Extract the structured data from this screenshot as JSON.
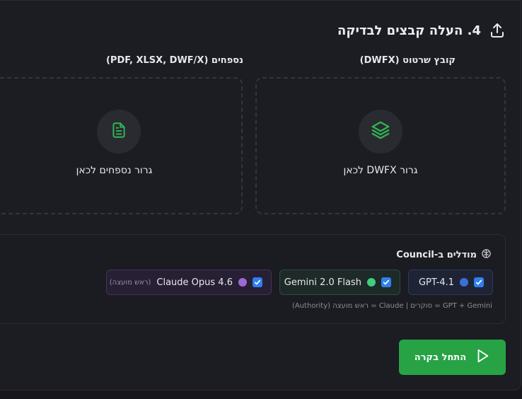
{
  "section": {
    "title": "4. העלה קבצים לבדיקה",
    "icon": "upload-icon"
  },
  "upload": {
    "drawing": {
      "label": "קובץ שרטוט (DWFX)",
      "drop_text": "גרור DWFX לכאן",
      "icon": "layers-icon"
    },
    "attachments": {
      "label": "נספחים (PDF, XLSX, DWF/X)",
      "drop_text": "גרור נספחים לכאן",
      "icon": "file-text-icon"
    }
  },
  "council": {
    "title": "מודלים ב-Council",
    "icon": "brain-icon",
    "models": [
      {
        "name": "GPT-4.1",
        "checked": true,
        "dot_color": "#3b6fd6"
      },
      {
        "name": "Gemini 2.0 Flash",
        "checked": true,
        "dot_color": "#3ecf7a"
      },
      {
        "name": "Claude Opus 4.6",
        "checked": true,
        "dot_color": "#9b6ad6",
        "tag": "(ראש מועצה)"
      }
    ],
    "note": "GPT + Gemini = סוקרים  |  Claude = ראש מועצה (Authority)"
  },
  "actions": {
    "start_label": "התחל בקרה",
    "start_icon": "play-icon"
  },
  "colors": {
    "accent_green": "#27a345",
    "checkbox_blue": "#2f7ff0",
    "icon_green": "#2fb553"
  }
}
